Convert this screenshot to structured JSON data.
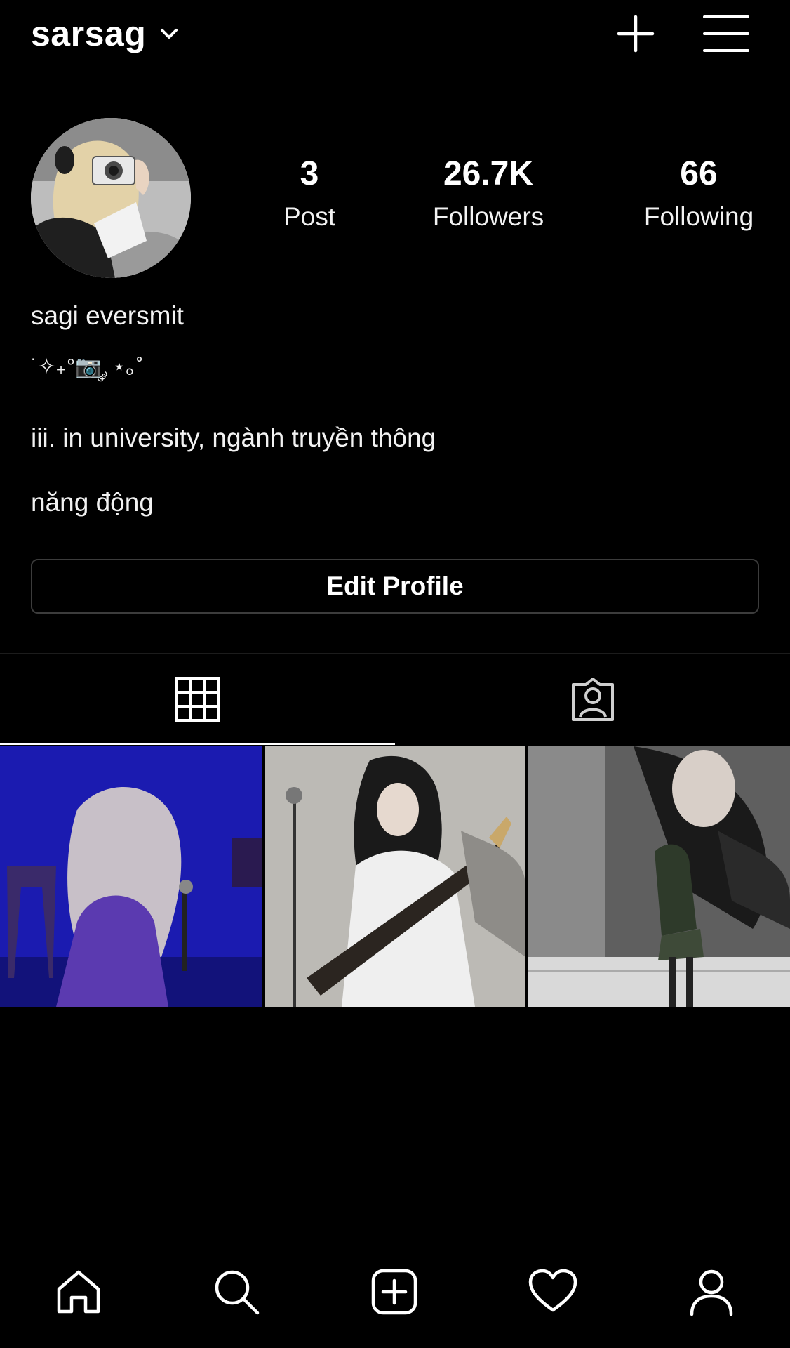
{
  "header": {
    "username": "sarsag",
    "chevron_icon": "chevron-down-icon",
    "new_post_icon": "plus-icon",
    "menu_icon": "hamburger-menu-icon"
  },
  "profile": {
    "avatar_icon": "profile-avatar",
    "stats": {
      "posts_count": "3",
      "posts_label": "Post",
      "followers_count": "26.7K",
      "followers_label": "Followers",
      "following_count": "66",
      "following_label": "Following"
    },
    "bio": {
      "name": "sagi eversmit",
      "emoji_line": "˙✧₊°📷 ༘ ⋆｡˚",
      "line1": "iii. in university, ngành truyền thông",
      "line2": "năng động"
    },
    "edit_profile_label": "Edit Profile"
  },
  "tabs": {
    "active": "grid",
    "items": [
      {
        "id": "grid",
        "icon": "grid-icon"
      },
      {
        "id": "tagged",
        "icon": "tagged-person-icon"
      }
    ]
  },
  "posts": [
    {
      "kind": "photo",
      "palette": "blue"
    },
    {
      "kind": "photo",
      "palette": "grey"
    },
    {
      "kind": "photo",
      "palette": "stage"
    }
  ],
  "bottom_nav": {
    "items": [
      "home-icon",
      "search-icon",
      "add-icon",
      "heart-icon",
      "profile-icon"
    ]
  },
  "colors": {
    "background": "#000000",
    "text": "#ffffff",
    "border": "#3c3c3c",
    "divider": "#1c1c1c"
  }
}
